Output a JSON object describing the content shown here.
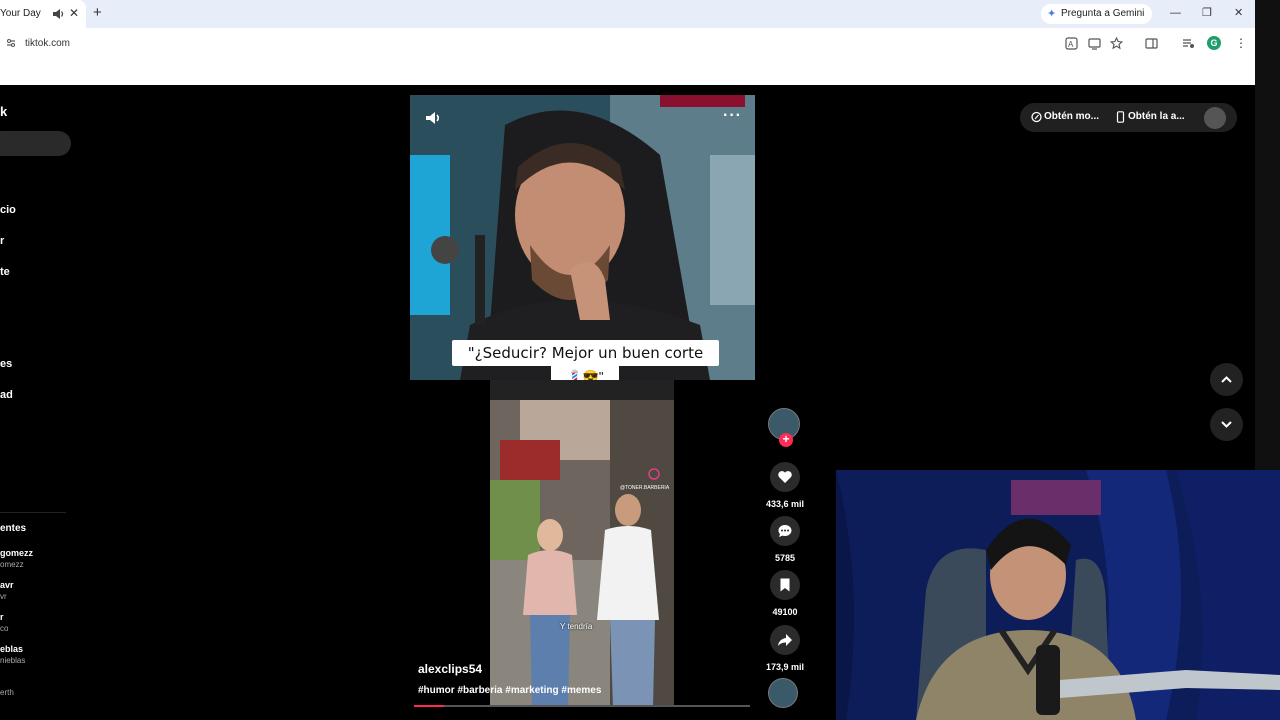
{
  "browser": {
    "tab_title": "Your Day",
    "new_tab_icon": "plus-icon",
    "gemini_label": "Pregunta a Gemini",
    "url": "tiktok.com",
    "profile_initial": "G"
  },
  "left_nav": {
    "logo": "k",
    "items": [
      "cio",
      "r",
      "te",
      "es",
      "ad"
    ],
    "following_title": "entes",
    "accounts": [
      {
        "name": "gomezz",
        "handle": "omezz"
      },
      {
        "name": "avr",
        "handle": "vr"
      },
      {
        "name": "r",
        "handle": "co"
      },
      {
        "name": "eblas",
        "handle": "nieblas"
      },
      {
        "name": "",
        "handle": "erth"
      }
    ]
  },
  "video": {
    "caption_line1": "\"¿Seducir? Mejor un buen corte",
    "caption_line2": "💈😎\"",
    "subtitle": "Y tendría",
    "watermark_handle": "@TONER.BARBERIA",
    "author": "alexclips54",
    "hashtags": "#humor #barberia #marketing #memes",
    "progress": 0.09
  },
  "actions": {
    "likes": "433,6 mil",
    "comments": "5785",
    "saves": "49100",
    "shares": "173,9 mil"
  },
  "top_right": {
    "get_coins": "Obtén mo...",
    "get_app": "Obtén la a..."
  },
  "colors": {
    "accent": "#fe2c55",
    "background": "#000000"
  }
}
